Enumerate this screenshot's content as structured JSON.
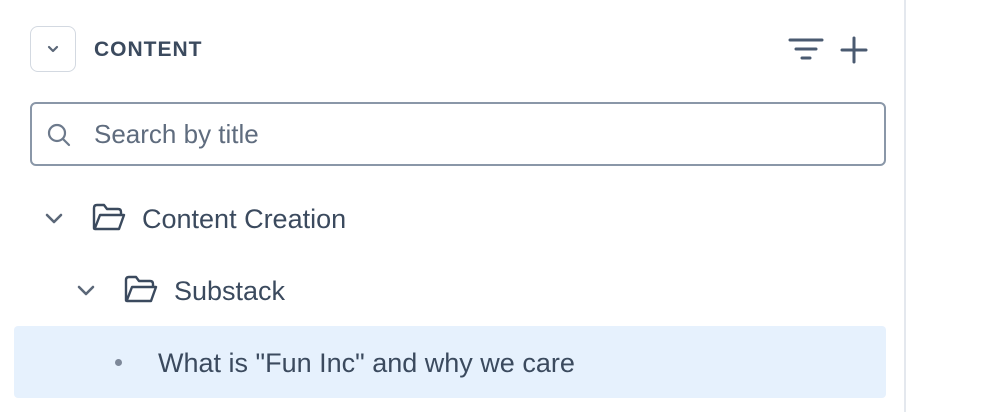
{
  "header": {
    "title": "CONTENT",
    "collapse_icon": "chevron-down-icon",
    "filter_icon": "filter-icon",
    "add_icon": "plus-icon"
  },
  "search": {
    "placeholder": "Search by title",
    "value": ""
  },
  "tree": {
    "items": [
      {
        "label": "Content Creation",
        "type": "folder",
        "expanded": true,
        "level": 0
      },
      {
        "label": "Substack",
        "type": "folder",
        "expanded": true,
        "level": 1
      },
      {
        "label": "What is \"Fun Inc\" and why we care",
        "type": "document",
        "selected": true,
        "level": 2
      }
    ]
  },
  "colors": {
    "text": "#3b4a5e",
    "border": "#8a97a8",
    "selected_bg": "#e6f1fd",
    "divider": "#e4e8ee"
  }
}
